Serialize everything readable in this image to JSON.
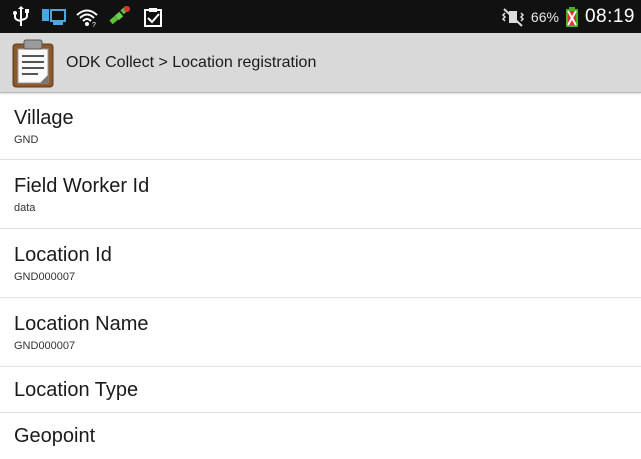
{
  "status_bar": {
    "icons": [
      "usb-icon",
      "screen-share-icon",
      "wifi-icon",
      "satellite-icon",
      "clipboard-check-icon"
    ],
    "mute_icon": "vibrate-mute-icon",
    "battery_percent": "66%",
    "battery_icon": "battery-charging-icon",
    "time": "08:19"
  },
  "title_bar": {
    "app_icon": "clipboard-icon",
    "title": "ODK Collect > Location registration"
  },
  "fields": [
    {
      "label": "Village",
      "value": "GND"
    },
    {
      "label": "Field Worker Id",
      "value": "data"
    },
    {
      "label": "Location Id",
      "value": "GND000007"
    },
    {
      "label": "Location Name",
      "value": "GND000007"
    },
    {
      "label": "Location Type",
      "value": ""
    },
    {
      "label": "Geopoint",
      "value": ""
    }
  ],
  "colors": {
    "status_bar_bg": "#111111",
    "title_bar_bg": "#d9d9d9",
    "battery_red": "#e03030",
    "battery_green": "#4caf20",
    "divider": "#e0e0e0"
  }
}
